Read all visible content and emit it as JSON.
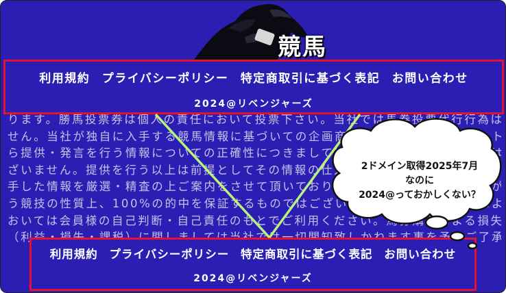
{
  "site_logo": {
    "text": "競馬"
  },
  "disclaimer_lines": [
    "ります。勝馬投票券は個人の責任において投票下さい。当社では馬券投票代行行為は行っておりま",
    "せん。当社が独自に入手する競馬情報に基づいての企画商品、またはインターネットサービス等か",
    "ら提供・発言を行う情報についての正確性につきましては一切の保証をするものではございませんご",
    "ざいません。提供を行う以上は前提としてその情報の仕入元・提供者の確認も行っておりますが入",
    "手した情報を厳選・精査の上ご案内をさせて頂いておりますが、競馬は様々な要因が絡み合",
    "う競技の性質上、100%の的中を保証するものではございませんので、情報提供による結果に",
    "おいては会員様の自己判断・自己責任のもとでご利用ください。馬券購入による損失及び結果",
    "（利益・損失・課税）に関しましては当社では一切関知致しかねます事を予めご了承ください。"
  ],
  "footer_top": {
    "links": [
      "利用規約",
      "プライバシーポリシー",
      "特定商取引に基づく表記",
      "お問い合わせ"
    ],
    "copyright": "2024@リベンジャーズ"
  },
  "footer_bottom": {
    "links": [
      "利用規約",
      "プライバシーポリシー",
      "特定商取引に基づく表記",
      "お問い合わせ"
    ],
    "copyright": "2024@リベンジャーズ"
  },
  "annotation": {
    "lines": [
      "2ドメイン取得2025年7月",
      "なのに",
      "2024@っておかしくない？"
    ]
  },
  "colors": {
    "background": "#2b1fb3",
    "highlight_box": "#e8112d",
    "connector_line": "#b9f27a"
  }
}
